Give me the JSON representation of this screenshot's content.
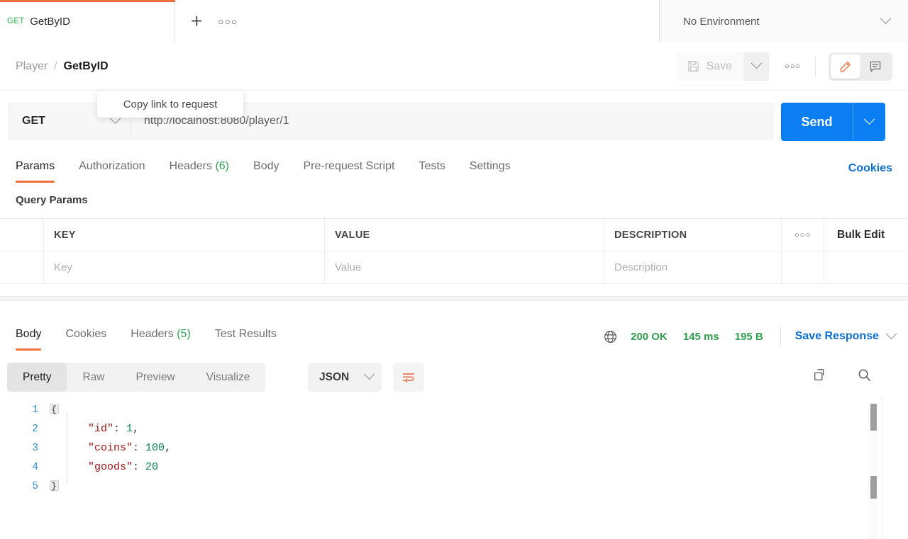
{
  "tabbar": {
    "tab": {
      "method": "GET",
      "title": "GetByID"
    },
    "new_tab_label": "+",
    "tab_options_label": "ooo",
    "environment": {
      "selected": "No Environment"
    }
  },
  "header": {
    "breadcrumb_parent": "Player",
    "breadcrumb_separator": "/",
    "breadcrumb_current": "GetByID",
    "save_label": "Save",
    "save_options_label": "ooo",
    "edit_icon_name": "pencil-icon",
    "comment_icon_name": "comment-icon"
  },
  "tooltip": {
    "text": "Copy link to request"
  },
  "request": {
    "method": "GET",
    "url": "http://localhost:8080/player/1",
    "send_label": "Send"
  },
  "request_tabs": [
    {
      "label": "Params",
      "count": "",
      "active": true
    },
    {
      "label": "Authorization",
      "count": "",
      "active": false
    },
    {
      "label": "Headers",
      "count": "(6)",
      "active": false
    },
    {
      "label": "Body",
      "count": "",
      "active": false
    },
    {
      "label": "Pre-request Script",
      "count": "",
      "active": false
    },
    {
      "label": "Tests",
      "count": "",
      "active": false
    },
    {
      "label": "Settings",
      "count": "",
      "active": false
    }
  ],
  "cookies_link": "Cookies",
  "query_params": {
    "title": "Query Params",
    "columns": [
      "KEY",
      "VALUE",
      "DESCRIPTION"
    ],
    "options_label": "ooo",
    "bulk_edit_label": "Bulk Edit",
    "placeholder_row": {
      "key": "Key",
      "value": "Value",
      "description": "Description"
    }
  },
  "response_tabs": [
    {
      "label": "Body",
      "count": "",
      "active": true
    },
    {
      "label": "Cookies",
      "count": "",
      "active": false
    },
    {
      "label": "Headers",
      "count": "(5)",
      "active": false
    },
    {
      "label": "Test Results",
      "count": "",
      "active": false
    }
  ],
  "response_meta": {
    "globe_icon_name": "globe-icon",
    "status": "200 OK",
    "time": "145 ms",
    "size": "195 B",
    "save_response_label": "Save Response"
  },
  "viewer": {
    "modes": [
      {
        "label": "Pretty",
        "active": true
      },
      {
        "label": "Raw",
        "active": false
      },
      {
        "label": "Preview",
        "active": false
      },
      {
        "label": "Visualize",
        "active": false
      }
    ],
    "format": "JSON",
    "wrap_icon_name": "word-wrap-icon",
    "copy_icon_name": "copy-icon",
    "search_icon_name": "search-icon"
  },
  "body": {
    "lines": [
      {
        "no": "1",
        "fold": "{",
        "text": ""
      },
      {
        "no": "2",
        "fold": "",
        "text": "    \"id\": 1,"
      },
      {
        "no": "3",
        "fold": "",
        "text": "    \"coins\": 100,"
      },
      {
        "no": "4",
        "fold": "",
        "text": "    \"goods\": 20"
      },
      {
        "no": "5",
        "fold": "}",
        "text": ""
      }
    ],
    "json": {
      "id": 1,
      "coins": 100,
      "goods": 20
    }
  },
  "colors": {
    "accent_orange": "#f2703b",
    "send_blue": "#0c7ef4",
    "link_blue": "#0c6fd6",
    "status_green": "#2e9e4f",
    "count_green": "#31a354",
    "json_key": "#a31515",
    "json_number": "#098658"
  }
}
